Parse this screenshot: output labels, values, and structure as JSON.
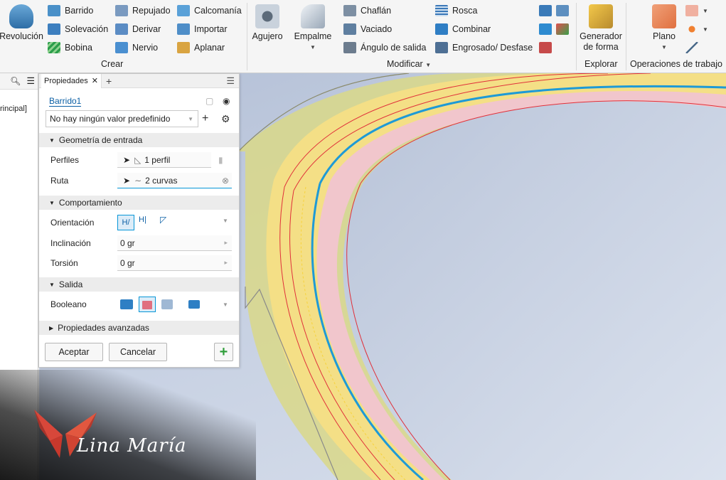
{
  "ribbon": {
    "crear": {
      "revolucion": "Revolución",
      "col1": [
        "Barrido",
        "Solevación",
        "Bobina"
      ],
      "col2": [
        "Repujado",
        "Derivar",
        "Nervio"
      ],
      "col3": [
        "Calcomanía",
        "Importar",
        "Aplanar"
      ],
      "panel_label": "Crear"
    },
    "modificar": {
      "agujero": "Agujero",
      "empalme": "Empalme",
      "col1": [
        "Chaflán",
        "Vaciado",
        "Ángulo de salida"
      ],
      "col2": [
        "Rosca",
        "Combinar",
        "Engrosado/ Desfase"
      ],
      "panel_label": "Modificar"
    },
    "explorar": {
      "generador": "Generador\nde forma",
      "panel_label": "Explorar"
    },
    "operaciones": {
      "plano": "Plano",
      "panel_label": "Operaciones de trabajo"
    }
  },
  "browser": {
    "node": "rincipal]"
  },
  "properties": {
    "tab_label": "Propiedades",
    "feature_name": "Barrido1",
    "preset": "No hay ningún valor predefinido",
    "sections": {
      "input_geometry": "Geometría de entrada",
      "behavior": "Comportamiento",
      "output": "Salida",
      "advanced": "Propiedades avanzadas"
    },
    "fields": {
      "profiles_label": "Perfiles",
      "profiles_value": "1 perfil",
      "path_label": "Ruta",
      "path_value": "2 curvas",
      "orientation_label": "Orientación",
      "taper_label": "Inclinación",
      "taper_value": "0 gr",
      "twist_label": "Torsión",
      "twist_value": "0 gr",
      "boolean_label": "Booleano"
    },
    "buttons": {
      "ok": "Aceptar",
      "cancel": "Cancelar"
    }
  },
  "watermark": {
    "signature": "Lina María"
  },
  "colors": {
    "accent": "#0696d7",
    "ribbon_bg": "#f5f5f5",
    "viewport_top": "#b3bfd6",
    "viewport_bottom": "#d8dfec",
    "part_yellow": "#f5e08a",
    "part_pink": "#f1c6cc",
    "path_blue": "#1e9ad6",
    "edge_red": "#e0303a",
    "add_green": "#2e9e3a"
  }
}
